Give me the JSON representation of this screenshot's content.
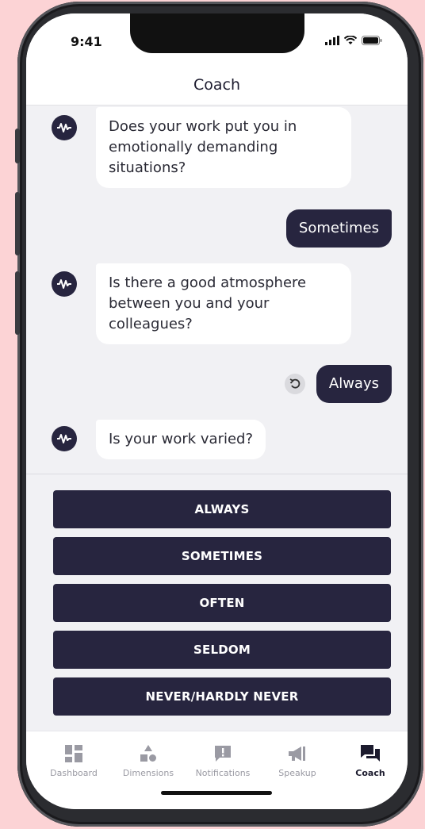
{
  "status_bar": {
    "time": "9:41"
  },
  "header": {
    "title": "Coach"
  },
  "messages": [
    {
      "from": "bot",
      "text": "Does your work put you in emotionally demanding situations?"
    },
    {
      "from": "user",
      "text": "Sometimes"
    },
    {
      "from": "bot",
      "text": "Is there a good atmosphere between you and your colleagues?"
    },
    {
      "from": "user",
      "text": "Always"
    },
    {
      "from": "bot",
      "text": "Is your work varied?"
    }
  ],
  "answers": [
    "ALWAYS",
    "SOMETIMES",
    "OFTEN",
    "SELDOM",
    "NEVER/HARDLY NEVER"
  ],
  "tabs": [
    {
      "label": "Dashboard",
      "icon": "dashboard-icon"
    },
    {
      "label": "Dimensions",
      "icon": "shapes-icon"
    },
    {
      "label": "Notifications",
      "icon": "alert-icon"
    },
    {
      "label": "Speakup",
      "icon": "megaphone-icon"
    },
    {
      "label": "Coach",
      "icon": "chat-icon",
      "active": true
    }
  ],
  "colors": {
    "background": "#fcd3d5",
    "primary": "#27253f",
    "inactive_tab": "#9a9aa3"
  }
}
